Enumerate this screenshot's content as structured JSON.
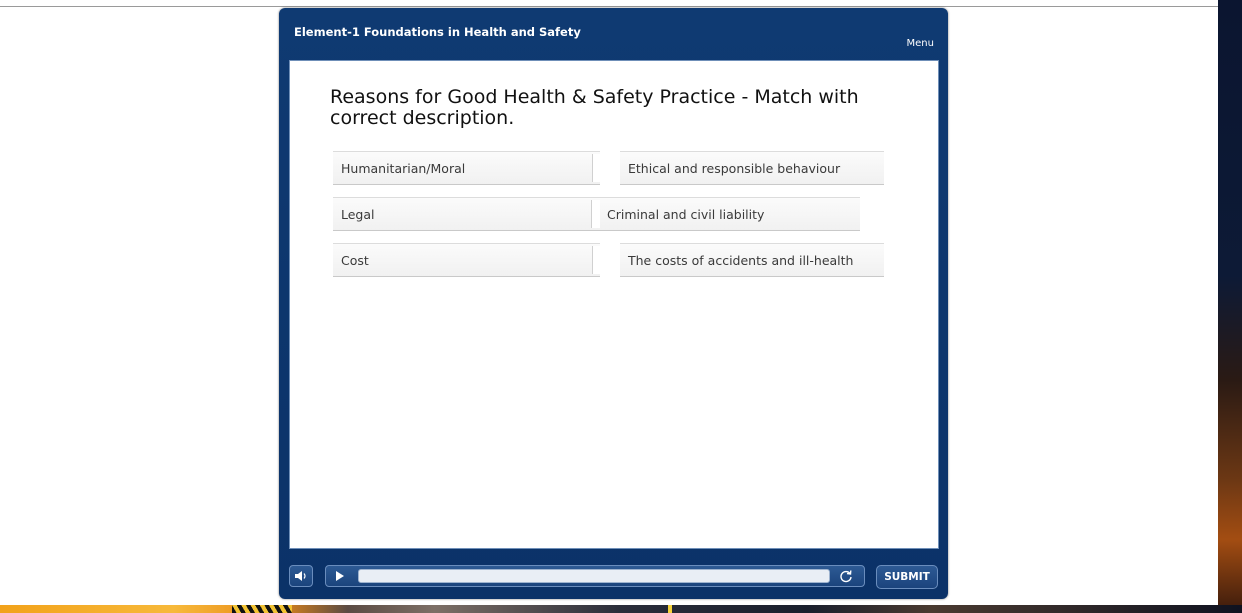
{
  "course": {
    "title": "Element-1 Foundations in Health and Safety",
    "menu_label": "Menu"
  },
  "question": {
    "text": "Reasons for Good Health & Safety Practice - Match with correct description."
  },
  "pairs": [
    {
      "term": "Humanitarian/Moral",
      "description": "Ethical and responsible behaviour"
    },
    {
      "term": "Legal",
      "description": "Criminal and civil liability"
    },
    {
      "term": "Cost",
      "description": "The costs of accidents and ill-health"
    }
  ],
  "controls": {
    "submit_label": "SUBMIT",
    "audio_icon": "speaker-icon",
    "play_icon": "play-icon",
    "replay_icon": "replay-icon"
  }
}
